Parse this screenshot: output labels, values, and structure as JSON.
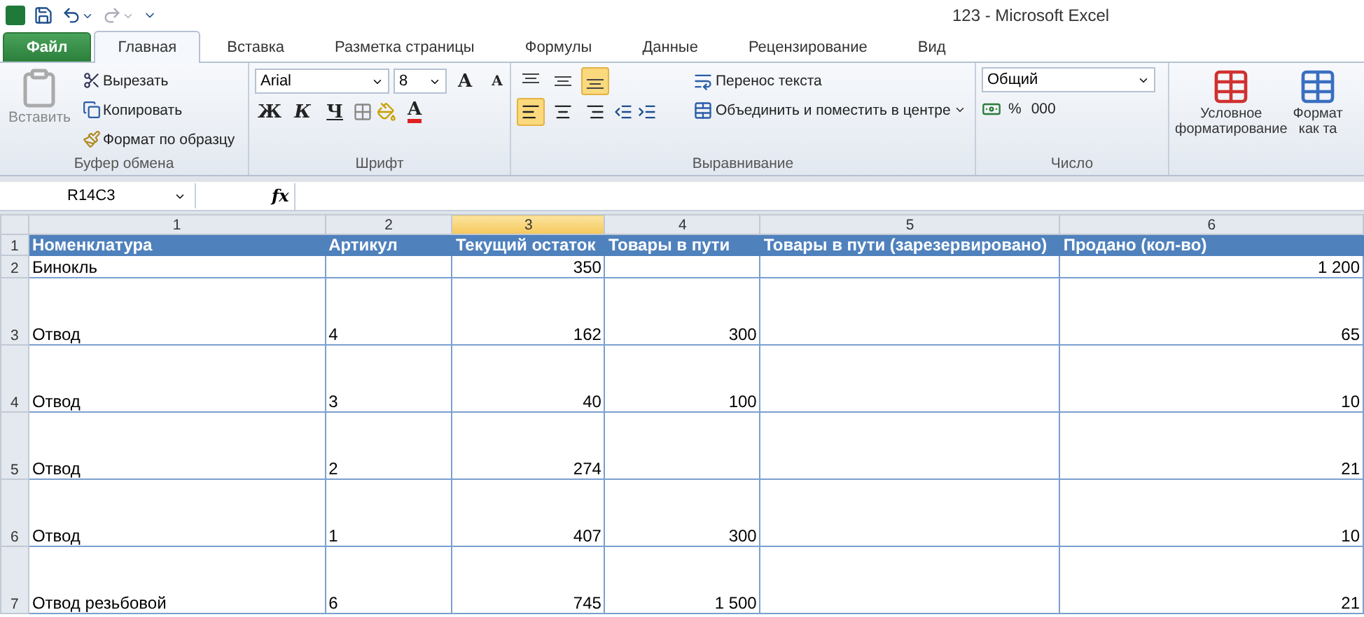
{
  "window": {
    "title": "123  -  Microsoft Excel"
  },
  "tabs": [
    {
      "label": "Файл",
      "kind": "file",
      "selected": false
    },
    {
      "label": "Главная",
      "kind": "tab",
      "selected": true
    },
    {
      "label": "Вставка",
      "kind": "tab",
      "selected": false
    },
    {
      "label": "Разметка страницы",
      "kind": "tab",
      "selected": false
    },
    {
      "label": "Формулы",
      "kind": "tab",
      "selected": false
    },
    {
      "label": "Данные",
      "kind": "tab",
      "selected": false
    },
    {
      "label": "Рецензирование",
      "kind": "tab",
      "selected": false
    },
    {
      "label": "Вид",
      "kind": "tab",
      "selected": false
    }
  ],
  "clipboard": {
    "paste": "Вставить",
    "cut": "Вырезать",
    "copy": "Копировать",
    "format_painter": "Формат по образцу",
    "label": "Буфер обмена"
  },
  "font": {
    "name": "Arial",
    "size": "8",
    "grow": "A",
    "shrink": "A",
    "bold": "Ж",
    "italic": "К",
    "underline": "Ч",
    "font_color_letter": "A",
    "label": "Шрифт"
  },
  "alignment": {
    "vertical": [
      {
        "selected": false
      },
      {
        "selected": false
      },
      {
        "selected": true
      }
    ],
    "horizontal": [
      {
        "selected": true
      },
      {
        "selected": false
      },
      {
        "selected": false
      }
    ],
    "wrap": "Перенос текста",
    "merge": "Объединить и поместить в центре",
    "label": "Выравнивание"
  },
  "number": {
    "format": "Общий",
    "percent": "%",
    "thousands": "000",
    "label": "Число"
  },
  "styles": {
    "conditional": [
      "Условное",
      "форматирование"
    ],
    "format_table": [
      "Формат",
      "как та"
    ]
  },
  "formula_bar": {
    "name_box": "R14C3",
    "fx": "fx"
  },
  "columns": [
    {
      "label": "1",
      "selected": false
    },
    {
      "label": "2",
      "selected": false
    },
    {
      "label": "3",
      "selected": true
    },
    {
      "label": "4",
      "selected": false
    },
    {
      "label": "5",
      "selected": false
    },
    {
      "label": "6",
      "selected": false
    }
  ],
  "rows": [
    {
      "number": "1",
      "kind": "header",
      "cells": [
        "Номенклатура",
        "Артикул",
        "Текущий остаток",
        "Товары в пути",
        "Товары в пути (зарезервировано)",
        "Продано (кол-во)"
      ]
    },
    {
      "number": "2",
      "kind": "normal",
      "cells": [
        "Бинокль",
        null,
        "350",
        null,
        null,
        "1 200"
      ]
    },
    {
      "number": "3",
      "kind": "tall",
      "cells": [
        "Отвод",
        "4",
        "162",
        "300",
        null,
        "65"
      ]
    },
    {
      "number": "4",
      "kind": "tall",
      "cells": [
        "Отвод",
        "3",
        "40",
        "100",
        null,
        "10"
      ]
    },
    {
      "number": "5",
      "kind": "tall",
      "cells": [
        "Отвод",
        "2",
        "274",
        null,
        null,
        "21"
      ]
    },
    {
      "number": "6",
      "kind": "tall",
      "cells": [
        "Отвод",
        "1",
        "407",
        "300",
        null,
        "10"
      ]
    },
    {
      "number": "7",
      "kind": "tall",
      "cells": [
        "Отвод резьбовой",
        "6",
        "745",
        "1 500",
        null,
        "21"
      ]
    }
  ]
}
